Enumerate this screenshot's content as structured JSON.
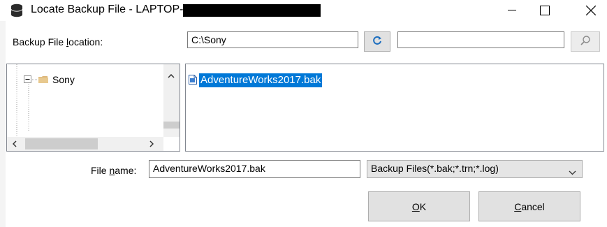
{
  "window": {
    "title": "Locate Backup File - LAPTOP-",
    "buttons": {
      "minimize_icon": "minimize-icon",
      "maximize_icon": "maximize-icon",
      "close_icon": "close-icon"
    }
  },
  "location": {
    "label_prefix": "Backup File ",
    "label_access": "l",
    "label_suffix": "ocation:",
    "path_value": "C:\\Sony",
    "refresh_icon": "refresh-icon",
    "search_value": "",
    "search_icon": "magnifier-icon"
  },
  "tree": {
    "items": [
      {
        "label": "Sony",
        "expanded": true
      }
    ]
  },
  "files": {
    "items": [
      {
        "name": "AdventureWorks2017.bak",
        "selected": true
      }
    ]
  },
  "filename": {
    "label_prefix": "File ",
    "label_access": "n",
    "label_suffix": "ame:",
    "value": "AdventureWorks2017.bak"
  },
  "filetype": {
    "selected": "Backup Files(*.bak;*.trn;*.log)"
  },
  "actions": {
    "ok_access": "O",
    "ok_rest": "K",
    "cancel_access": "C",
    "cancel_rest": "ancel"
  },
  "colors": {
    "selection": "#0078d7",
    "accent_icon": "#1e6fbf"
  }
}
